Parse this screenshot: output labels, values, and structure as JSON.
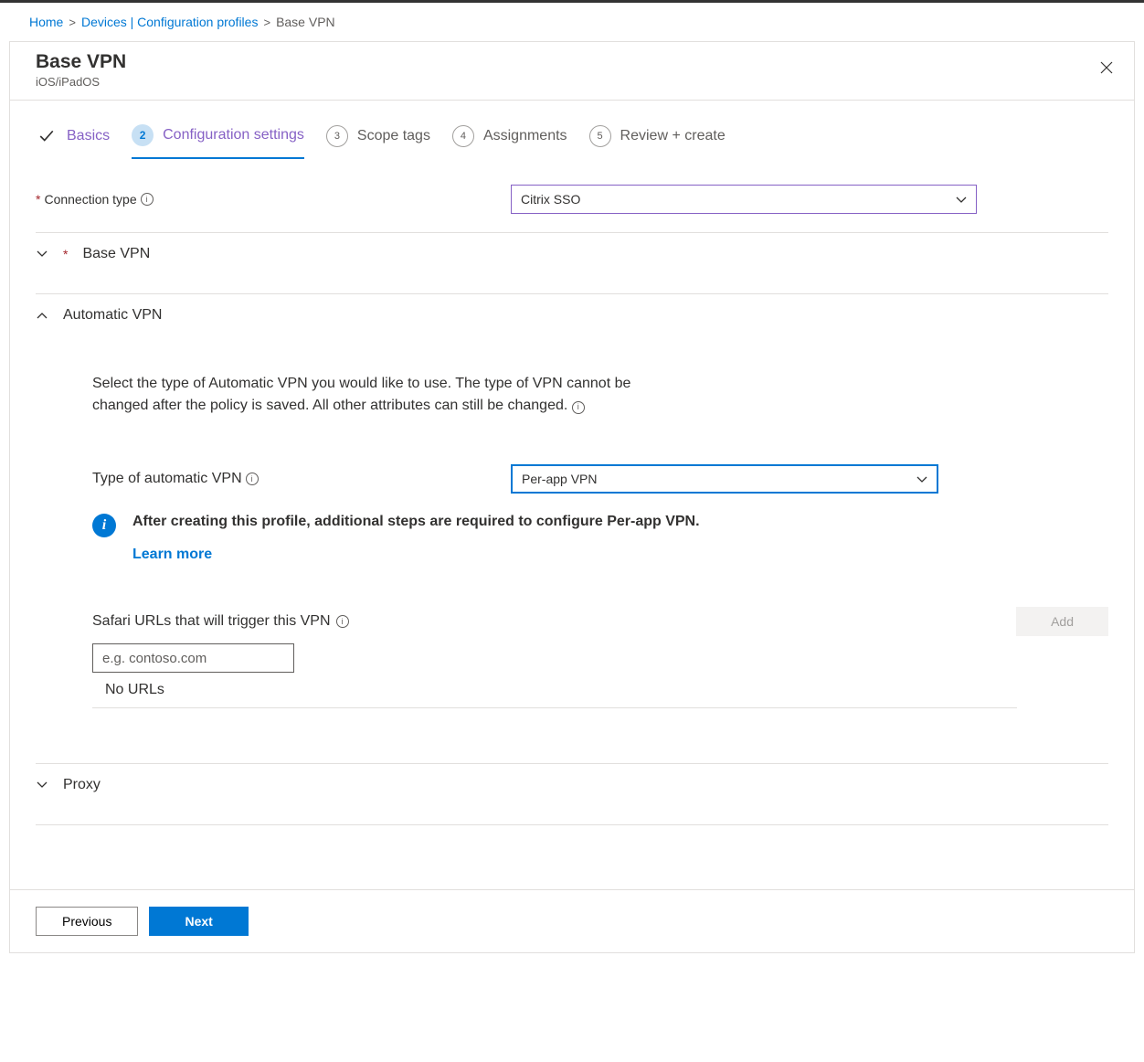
{
  "breadcrumb": {
    "home": "Home",
    "devices": "Devices | Configuration profiles",
    "current": "Base VPN"
  },
  "header": {
    "title": "Base VPN",
    "subtitle": "iOS/iPadOS"
  },
  "wizard": {
    "steps": [
      {
        "label": "Basics"
      },
      {
        "num": "2",
        "label": "Configuration settings"
      },
      {
        "num": "3",
        "label": "Scope tags"
      },
      {
        "num": "4",
        "label": "Assignments"
      },
      {
        "num": "5",
        "label": "Review + create"
      }
    ]
  },
  "connection_type": {
    "label": "Connection type",
    "value": "Citrix SSO"
  },
  "sections": {
    "base_vpn": "Base VPN",
    "automatic_vpn": "Automatic VPN",
    "proxy": "Proxy"
  },
  "automatic_vpn": {
    "description": "Select the type of Automatic VPN you would like to use. The type of VPN cannot be changed after the policy is saved. All other attributes can still be changed.",
    "type_label": "Type of automatic VPN",
    "type_value": "Per-app VPN",
    "info_text": "After creating this profile, additional steps are required to configure Per-app VPN.",
    "learn_more": "Learn more",
    "safari_label": "Safari URLs that will trigger this VPN",
    "url_placeholder": "e.g. contoso.com",
    "no_urls": "No URLs",
    "add_btn": "Add"
  },
  "footer": {
    "previous": "Previous",
    "next": "Next"
  }
}
